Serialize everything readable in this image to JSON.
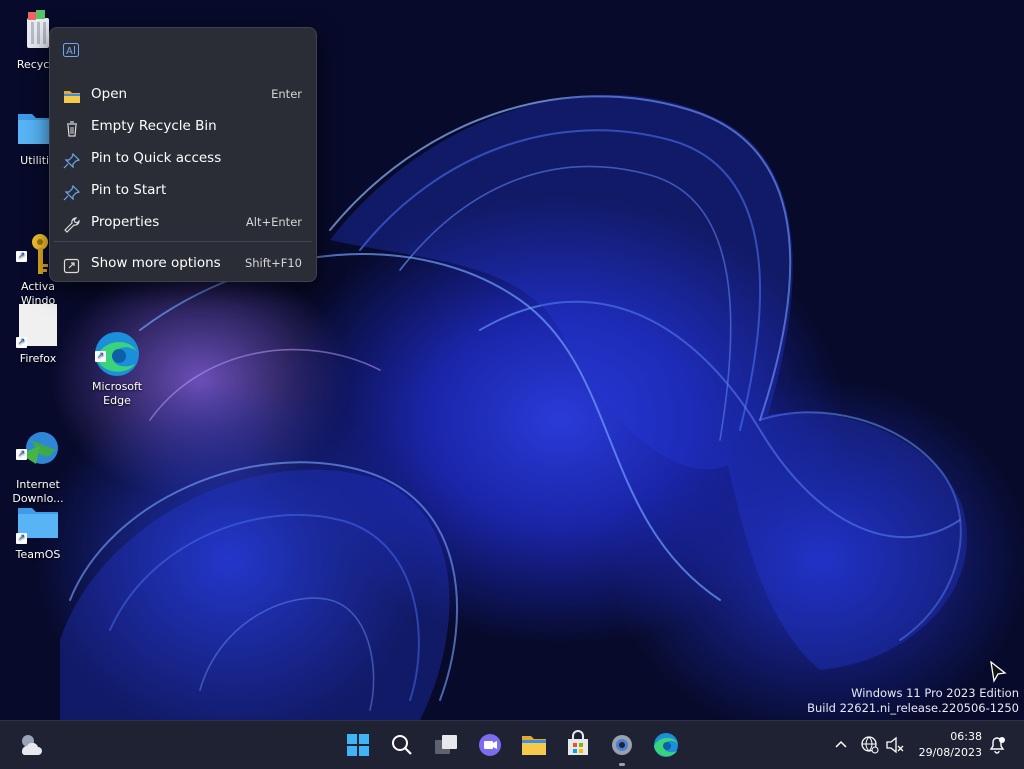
{
  "desktop": {
    "icons": [
      {
        "label": "Recycle"
      },
      {
        "label": "Utilitie"
      },
      {
        "label": "Activa\nWindo"
      },
      {
        "label": "Firefox"
      },
      {
        "label": "Microsoft\nEdge"
      },
      {
        "label": "Internet\nDownlo..."
      },
      {
        "label": "TeamOS"
      }
    ]
  },
  "context_menu": {
    "items": [
      {
        "label": "Open",
        "shortcut": "Enter",
        "icon": "folder-icon"
      },
      {
        "label": "Empty Recycle Bin",
        "shortcut": "",
        "icon": "trash-icon"
      },
      {
        "label": "Pin to Quick access",
        "shortcut": "",
        "icon": "pin-icon"
      },
      {
        "label": "Pin to Start",
        "shortcut": "",
        "icon": "pin-icon"
      },
      {
        "label": "Properties",
        "shortcut": "Alt+Enter",
        "icon": "wrench-icon"
      },
      {
        "label": "Show more options",
        "shortcut": "Shift+F10",
        "icon": "expand-icon"
      }
    ]
  },
  "watermark": {
    "line1": "Windows 11 Pro 2023 Edition",
    "line2": "Build 22621.ni_release.220506-1250"
  },
  "taskbar": {
    "time": "06:38",
    "date": "29/08/2023"
  },
  "colors": {
    "accent": "#1a5fd1",
    "taskbar": "#1f2233",
    "menu": "#2b2d36"
  }
}
